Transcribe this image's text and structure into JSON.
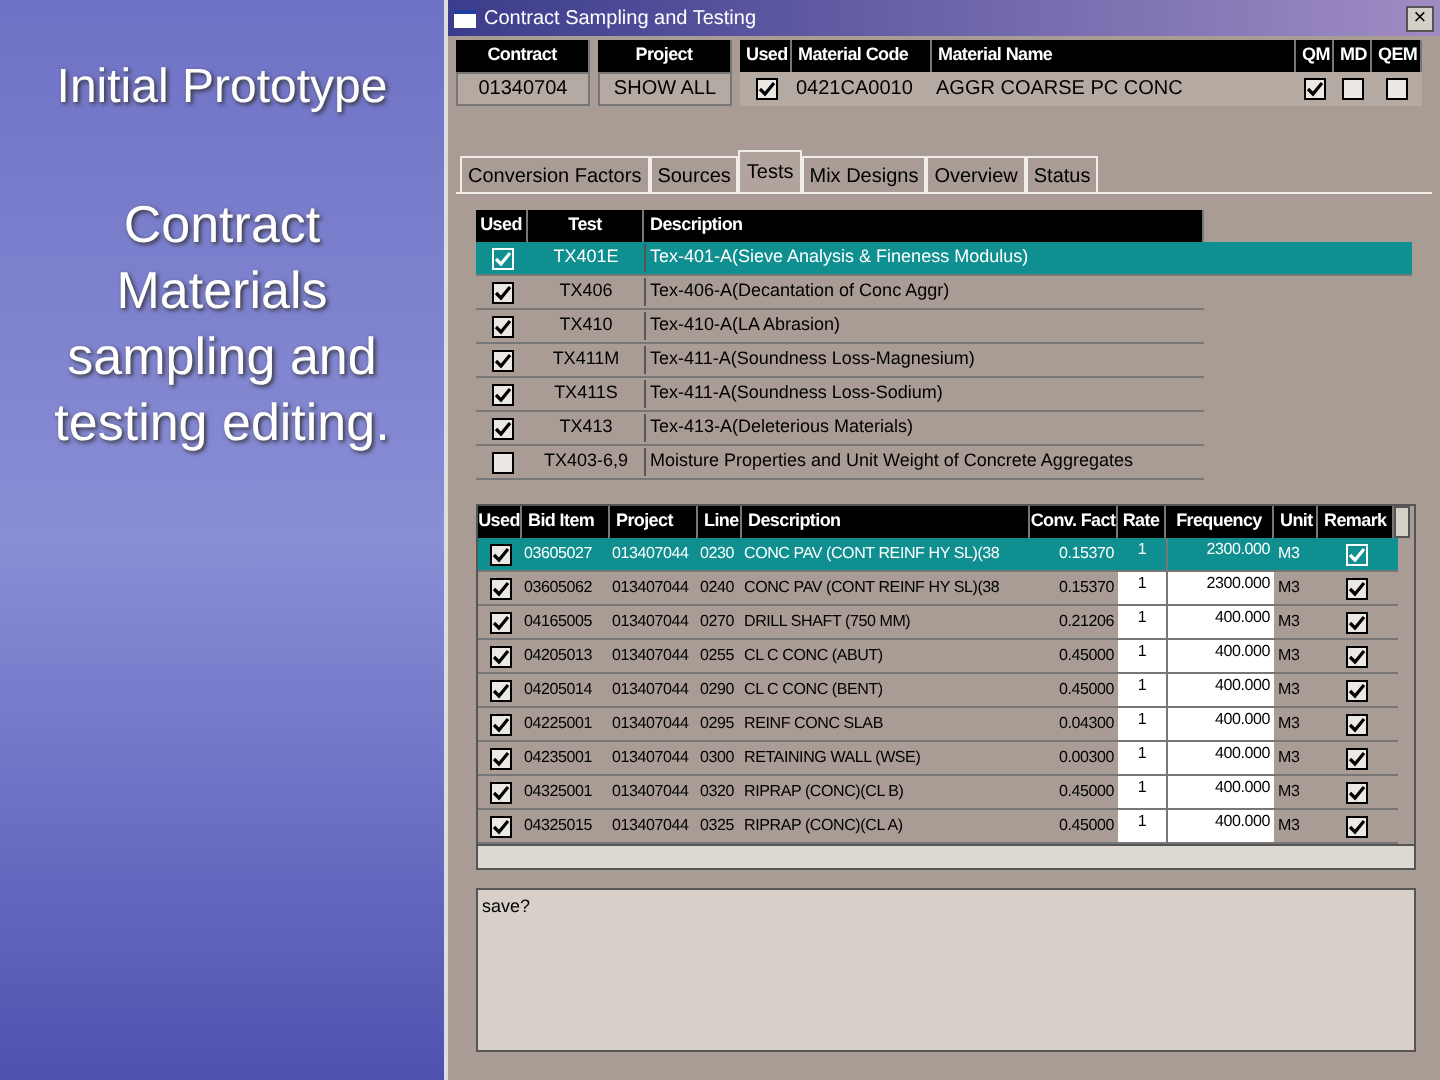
{
  "slide": {
    "title": "Initial Prototype",
    "body": "Contract Materials sampling and testing editing."
  },
  "window": {
    "title": "Contract Sampling and Testing",
    "close": "×"
  },
  "contract_grid": {
    "columns": [
      "Contract",
      "Project",
      "Used",
      "Material Code",
      "Material Name",
      "QM",
      "MD",
      "QEM"
    ],
    "row": {
      "contract": "01340704",
      "project": "SHOW ALL",
      "used": true,
      "material_code": "0421CA0010",
      "material_name": "AGGR COARSE PC CONC",
      "qm": true,
      "md": false,
      "qem": false
    }
  },
  "tabs": [
    {
      "label": "Conversion Factors",
      "selected": false
    },
    {
      "label": "Sources",
      "selected": false
    },
    {
      "label": "Tests",
      "selected": true
    },
    {
      "label": "Mix Designs",
      "selected": false
    },
    {
      "label": "Overview",
      "selected": false
    },
    {
      "label": "Status",
      "selected": false
    }
  ],
  "tests_grid": {
    "columns": [
      "Used",
      "Test",
      "Description"
    ],
    "rows": [
      {
        "used": true,
        "test": "TX401E",
        "description": "Tex-401-A(Sieve Analysis & Fineness Modulus)",
        "selected": true
      },
      {
        "used": true,
        "test": "TX406",
        "description": "Tex-406-A(Decantation of Conc Aggr)",
        "selected": false
      },
      {
        "used": true,
        "test": "TX410",
        "description": "Tex-410-A(LA Abrasion)",
        "selected": false
      },
      {
        "used": true,
        "test": "TX411M",
        "description": "Tex-411-A(Soundness Loss-Magnesium)",
        "selected": false
      },
      {
        "used": true,
        "test": "TX411S",
        "description": "Tex-411-A(Soundness Loss-Sodium)",
        "selected": false
      },
      {
        "used": true,
        "test": "TX413",
        "description": "Tex-413-A(Deleterious Materials)",
        "selected": false
      },
      {
        "used": false,
        "test": "TX403-6,9",
        "description": "Moisture Properties and Unit Weight of Concrete Aggregates",
        "selected": false
      }
    ]
  },
  "materials_grid": {
    "columns": [
      "Used",
      "Bid Item",
      "Project",
      "Line",
      "Description",
      "Conv. Fact",
      "Rate",
      "Frequency",
      "Unit",
      "Remark"
    ],
    "rows": [
      {
        "used": true,
        "bid_item": "03605027",
        "project": "013407044",
        "line": "0230",
        "description": "CONC PAV (CONT REINF HY SL)(38",
        "conv_fact": "0.15370",
        "rate": "1",
        "frequency": "2300.000",
        "unit": "M3",
        "remark": true,
        "selected": true
      },
      {
        "used": true,
        "bid_item": "03605062",
        "project": "013407044",
        "line": "0240",
        "description": "CONC PAV (CONT REINF HY SL)(38",
        "conv_fact": "0.15370",
        "rate": "1",
        "frequency": "2300.000",
        "unit": "M3",
        "remark": true,
        "selected": false
      },
      {
        "used": true,
        "bid_item": "04165005",
        "project": "013407044",
        "line": "0270",
        "description": "DRILL SHAFT (750 MM)",
        "conv_fact": "0.21206",
        "rate": "1",
        "frequency": "400.000",
        "unit": "M3",
        "remark": true,
        "selected": false
      },
      {
        "used": true,
        "bid_item": "04205013",
        "project": "013407044",
        "line": "0255",
        "description": "CL C CONC (ABUT)",
        "conv_fact": "0.45000",
        "rate": "1",
        "frequency": "400.000",
        "unit": "M3",
        "remark": true,
        "selected": false
      },
      {
        "used": true,
        "bid_item": "04205014",
        "project": "013407044",
        "line": "0290",
        "description": "CL C CONC (BENT)",
        "conv_fact": "0.45000",
        "rate": "1",
        "frequency": "400.000",
        "unit": "M3",
        "remark": true,
        "selected": false
      },
      {
        "used": true,
        "bid_item": "04225001",
        "project": "013407044",
        "line": "0295",
        "description": "REINF CONC SLAB",
        "conv_fact": "0.04300",
        "rate": "1",
        "frequency": "400.000",
        "unit": "M3",
        "remark": true,
        "selected": false
      },
      {
        "used": true,
        "bid_item": "04235001",
        "project": "013407044",
        "line": "0300",
        "description": "RETAINING WALL (WSE)",
        "conv_fact": "0.00300",
        "rate": "1",
        "frequency": "400.000",
        "unit": "M3",
        "remark": true,
        "selected": false
      },
      {
        "used": true,
        "bid_item": "04325001",
        "project": "013407044",
        "line": "0320",
        "description": "RIPRAP (CONC)(CL B)",
        "conv_fact": "0.45000",
        "rate": "1",
        "frequency": "400.000",
        "unit": "M3",
        "remark": true,
        "selected": false
      },
      {
        "used": true,
        "bid_item": "04325015",
        "project": "013407044",
        "line": "0325",
        "description": "RIPRAP (CONC)(CL A)",
        "conv_fact": "0.45000",
        "rate": "1",
        "frequency": "400.000",
        "unit": "M3",
        "remark": true,
        "selected": false
      }
    ]
  },
  "remarks": {
    "value": "save?"
  }
}
